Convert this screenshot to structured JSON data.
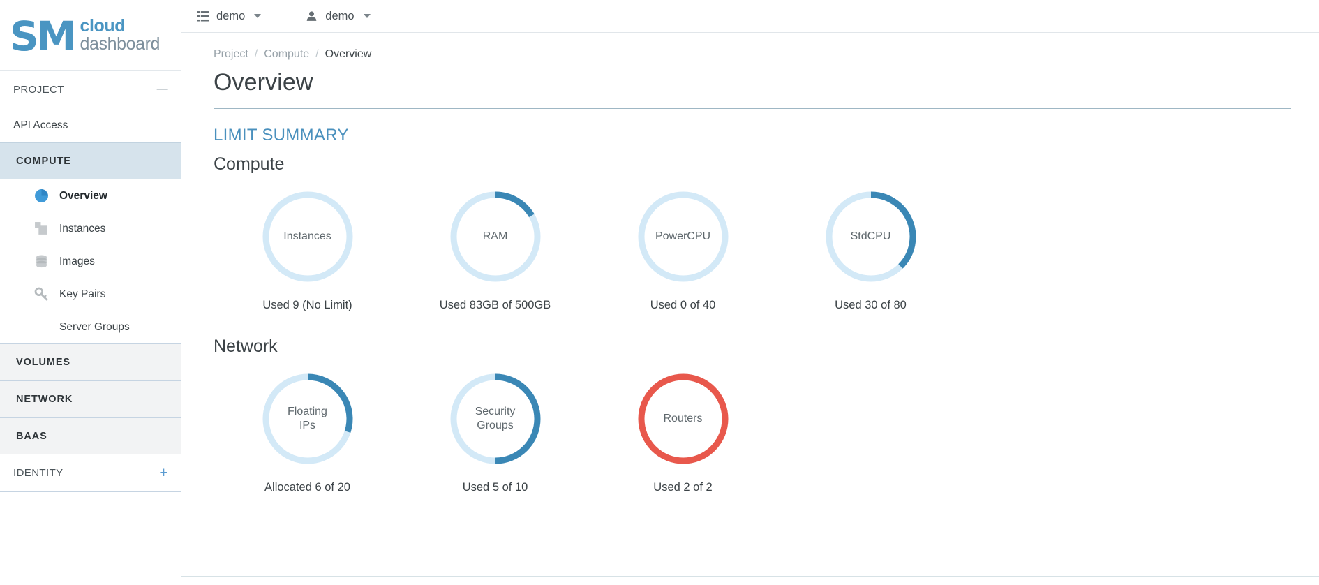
{
  "brand": {
    "mark": "SM",
    "word_top": "cloud",
    "word_bottom": "dashboard"
  },
  "topbar": {
    "project_selector": {
      "label": "demo",
      "icon": "grid-icon"
    },
    "user_selector": {
      "label": "demo",
      "icon": "user-icon"
    }
  },
  "sidebar": {
    "project_label": "PROJECT",
    "project_toggle": "—",
    "identity_label": "IDENTITY",
    "identity_toggle": "+",
    "api_access": "API Access",
    "compute_label": "COMPUTE",
    "compute_items": [
      {
        "label": "Overview",
        "icon": "pie-chart-icon",
        "current": true
      },
      {
        "label": "Instances",
        "icon": "instances-icon",
        "current": false
      },
      {
        "label": "Images",
        "icon": "database-icon",
        "current": false
      },
      {
        "label": "Key Pairs",
        "icon": "key-icon",
        "current": false
      },
      {
        "label": "Server Groups",
        "icon": "none",
        "current": false
      }
    ],
    "groups": [
      {
        "label": "VOLUMES"
      },
      {
        "label": "NETWORK"
      },
      {
        "label": "BAAS"
      }
    ]
  },
  "breadcrumb": {
    "items": [
      "Project",
      "Compute",
      "Overview"
    ],
    "separator": "/"
  },
  "page": {
    "title": "Overview",
    "limit_summary": "LIMIT SUMMARY"
  },
  "colors": {
    "arc_blue": "#3a87b5",
    "track_blue": "#d3e9f7",
    "arc_red": "#e8584c",
    "accent": "#4a90bd"
  },
  "chart_data": [
    {
      "type": "pie",
      "title": "Compute",
      "gauges": [
        {
          "label": "Instances",
          "caption": "Used 9 (No Limit)",
          "used": 9,
          "limit": null,
          "percent": 0,
          "color": "#d3e9f7",
          "unlimited": true
        },
        {
          "label": "RAM",
          "caption": "Used 83GB of 500GB",
          "used": 83,
          "limit": 500,
          "percent": 16.6,
          "color": "#3a87b5",
          "unit": "GB"
        },
        {
          "label": "PowerCPU",
          "caption": "Used 0 of 40",
          "used": 0,
          "limit": 40,
          "percent": 0,
          "color": "#d3e9f7"
        },
        {
          "label": "StdCPU",
          "caption": "Used 30 of 80",
          "used": 30,
          "limit": 80,
          "percent": 37.5,
          "color": "#3a87b5"
        }
      ]
    },
    {
      "type": "pie",
      "title": "Network",
      "gauges": [
        {
          "label": "Floating IPs",
          "caption": "Allocated 6 of 20",
          "used": 6,
          "limit": 20,
          "percent": 30,
          "color": "#3a87b5"
        },
        {
          "label": "Security Groups",
          "caption": "Used 5 of 10",
          "used": 5,
          "limit": 10,
          "percent": 50,
          "color": "#3a87b5"
        },
        {
          "label": "Routers",
          "caption": "Used 2 of 2",
          "used": 2,
          "limit": 2,
          "percent": 100,
          "color": "#e8584c"
        }
      ]
    }
  ]
}
